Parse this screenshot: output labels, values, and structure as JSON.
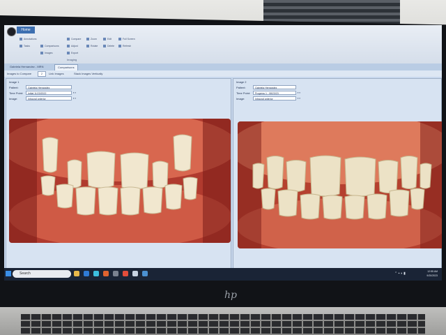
{
  "window": {
    "tabs": [
      "Home"
    ],
    "ribbon_buttons": [
      "Annotations",
      "Comparisons",
      "Compare",
      "Zoom",
      "Rotate",
      "Full Screen",
      "Edit",
      "Delete",
      "Refresh",
      "Tasks",
      "Images",
      "Adjust",
      "Export"
    ],
    "ribbon_group": "Imaging",
    "doc_tabs": [
      "Gabriela Hernandez - MRN",
      "Comparisons"
    ]
  },
  "toolbar": {
    "images_to_compare_label": "Images to Compare",
    "images_count": "2",
    "link_images": "Link Images",
    "stack_images": "Stack Images Vertically"
  },
  "left_image": {
    "heading": "Image 1",
    "patient_label": "Patient:",
    "patient_value": "Gabriela Hernandez",
    "timepoint_label": "Time Point:",
    "timepoint_value": "Initial 11/23/2022",
    "image_label": "Image:",
    "image_value": "Intraoral anterior"
  },
  "right_image": {
    "heading": "Image 2",
    "patient_label": "Patient:",
    "patient_value": "Gabriela Hernandez",
    "timepoint_label": "Time Point:",
    "timepoint_value": "Progress 1 - 08/23/23",
    "image_label": "Image:",
    "image_value": "Intraoral anterior"
  },
  "taskbar": {
    "search_placeholder": "Search",
    "time": "12:55 AM",
    "date": "9/20/2023"
  },
  "laptop_logo": "hp",
  "colors": {
    "ribbon_accent": "#3d6fb0",
    "taskbar": "#1a2436",
    "gum": "#c44a3a"
  }
}
